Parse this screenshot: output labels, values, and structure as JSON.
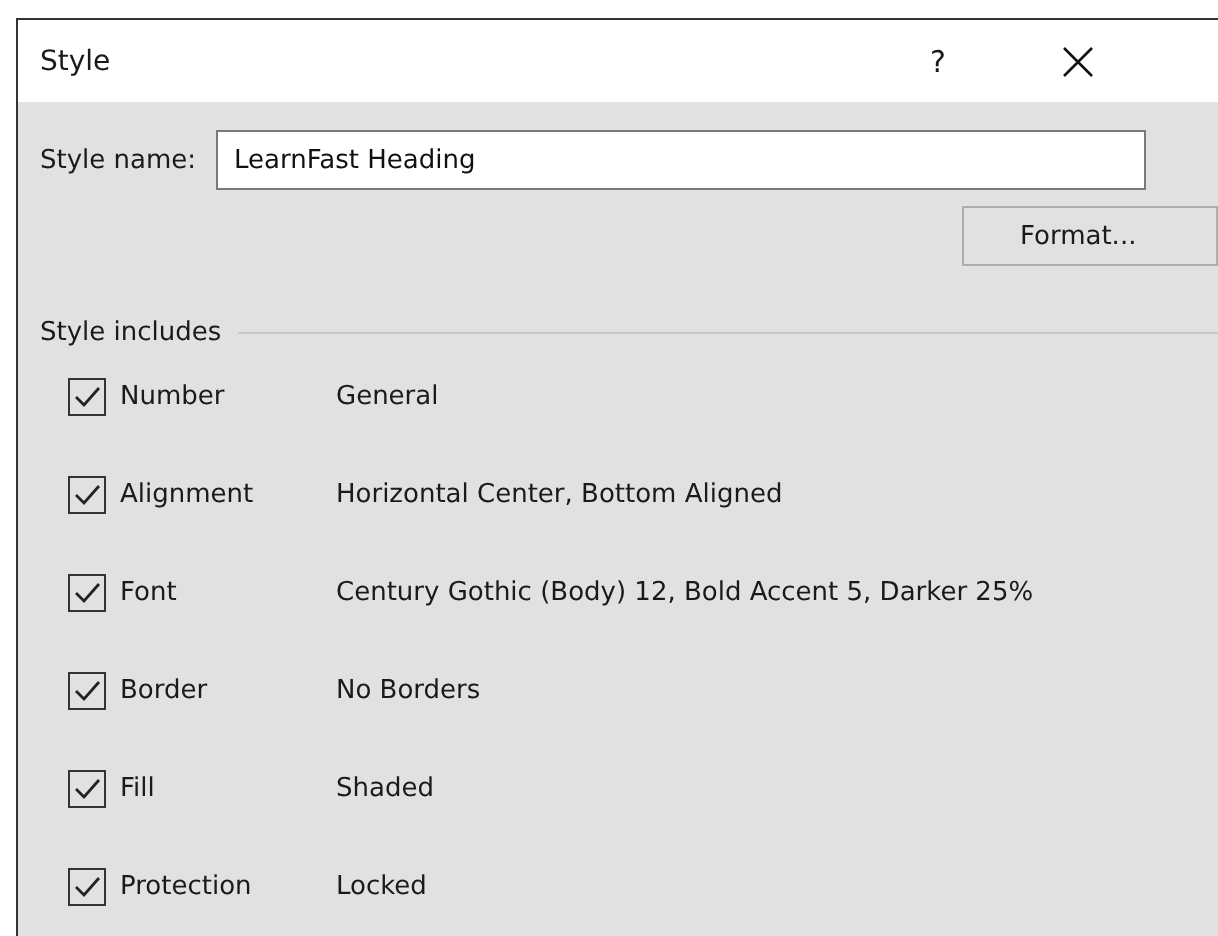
{
  "window": {
    "title": "Style",
    "help": "?"
  },
  "style_name": {
    "label": "Style name:",
    "value": "LearnFast Heading"
  },
  "format_button": {
    "label": "Format..."
  },
  "style_includes": {
    "heading": "Style includes",
    "items": [
      {
        "label": "Number",
        "checked": true,
        "value": "General"
      },
      {
        "label": "Alignment",
        "checked": true,
        "value": "Horizontal Center, Bottom Aligned"
      },
      {
        "label": "Font",
        "checked": true,
        "value": "Century Gothic (Body) 12, Bold Accent 5, Darker 25%"
      },
      {
        "label": "Border",
        "checked": true,
        "value": "No Borders"
      },
      {
        "label": "Fill",
        "checked": true,
        "value": "Shaded"
      },
      {
        "label": "Protection",
        "checked": true,
        "value": "Locked"
      }
    ]
  }
}
